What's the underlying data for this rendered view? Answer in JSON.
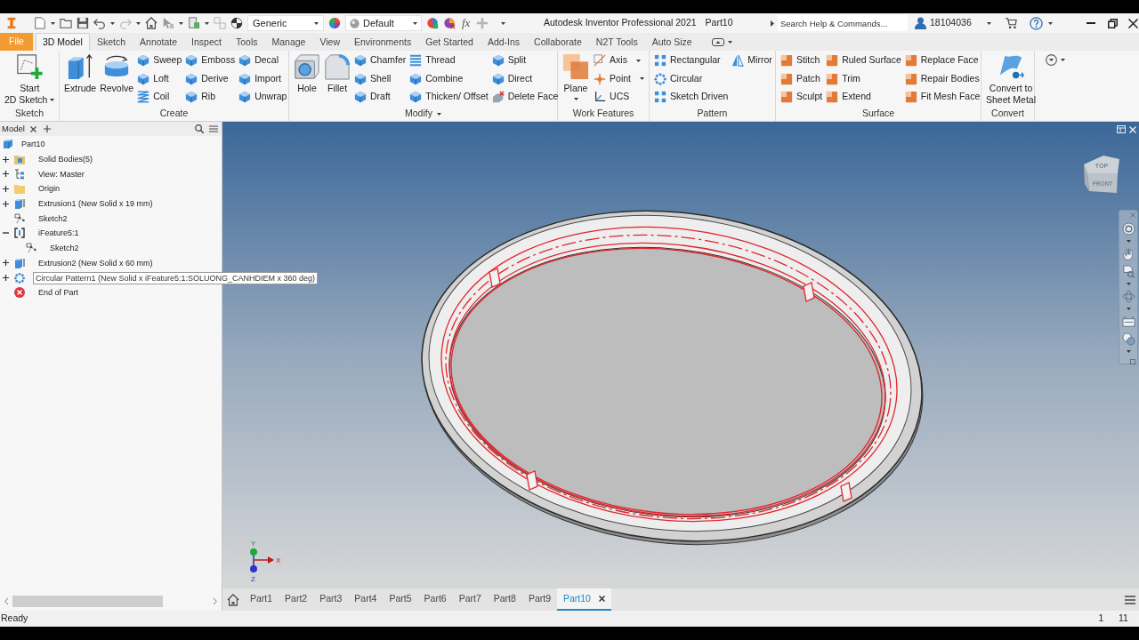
{
  "quick_access": {
    "style": "Generic",
    "appearance": "Default",
    "function_button": "fx"
  },
  "title_bar": {
    "app": "Autodesk Inventor Professional 2021",
    "document": "Part10",
    "search": {
      "placeholder": "Search Help & Commands..."
    },
    "user": "18104036"
  },
  "ribbon_tabs": [
    {
      "label": "File",
      "kind": "file",
      "selected": false
    },
    {
      "label": "3D Model",
      "kind": "tab",
      "selected": true
    },
    {
      "label": "Sketch",
      "kind": "tab",
      "selected": false
    },
    {
      "label": "Annotate",
      "kind": "tab",
      "selected": false
    },
    {
      "label": "Inspect",
      "kind": "tab",
      "selected": false
    },
    {
      "label": "Tools",
      "kind": "tab",
      "selected": false
    },
    {
      "label": "Manage",
      "kind": "tab",
      "selected": false
    },
    {
      "label": "View",
      "kind": "tab",
      "selected": false
    },
    {
      "label": "Environments",
      "kind": "tab",
      "selected": false
    },
    {
      "label": "Get Started",
      "kind": "tab",
      "selected": false
    },
    {
      "label": "Add-Ins",
      "kind": "tab",
      "selected": false
    },
    {
      "label": "Collaborate",
      "kind": "tab",
      "selected": false
    },
    {
      "label": "N2T Tools",
      "kind": "tab",
      "selected": false
    },
    {
      "label": "Auto Size",
      "kind": "tab",
      "selected": false
    }
  ],
  "ribbon_panels": [
    {
      "title": "Sketch",
      "columns": [
        {
          "kind": "large",
          "buttons": [
            {
              "lines": [
                "Start",
                "2D Sketch"
              ],
              "dropdown": true
            }
          ]
        }
      ]
    },
    {
      "title": "Create",
      "columns": [
        {
          "kind": "large",
          "buttons": [
            {
              "lines": [
                "Extrude"
              ]
            }
          ]
        },
        {
          "kind": "large",
          "buttons": [
            {
              "lines": [
                "Revolve"
              ]
            }
          ]
        },
        {
          "kind": "small",
          "buttons": [
            {
              "label": "Sweep"
            },
            {
              "label": "Loft"
            },
            {
              "label": "Coil"
            }
          ]
        },
        {
          "kind": "small",
          "buttons": [
            {
              "label": "Emboss"
            },
            {
              "label": "Derive"
            },
            {
              "label": "Rib"
            }
          ]
        },
        {
          "kind": "small",
          "buttons": [
            {
              "label": "Decal"
            },
            {
              "label": "Import"
            },
            {
              "label": "Unwrap"
            }
          ]
        }
      ]
    },
    {
      "title": "Modify",
      "title_dropdown": true,
      "columns": [
        {
          "kind": "large",
          "buttons": [
            {
              "lines": [
                "Hole"
              ]
            }
          ]
        },
        {
          "kind": "large",
          "buttons": [
            {
              "lines": [
                "Fillet"
              ]
            }
          ]
        },
        {
          "kind": "small",
          "buttons": [
            {
              "label": "Chamfer"
            },
            {
              "label": "Shell"
            },
            {
              "label": "Draft"
            }
          ]
        },
        {
          "kind": "small",
          "buttons": [
            {
              "label": "Thread"
            },
            {
              "label": "Combine"
            },
            {
              "label": "Thicken/ Offset"
            }
          ]
        },
        {
          "kind": "small",
          "buttons": [
            {
              "label": "Split"
            },
            {
              "label": "Direct"
            },
            {
              "label": "Delete Face"
            }
          ]
        }
      ]
    },
    {
      "title": "Work Features",
      "columns": [
        {
          "kind": "large",
          "buttons": [
            {
              "lines": [
                "Plane"
              ],
              "dropdown": true
            }
          ]
        },
        {
          "kind": "small",
          "buttons": [
            {
              "label": "Axis",
              "dropdown": true
            },
            {
              "label": "Point",
              "dropdown": true
            },
            {
              "label": "UCS"
            }
          ]
        }
      ]
    },
    {
      "title": "Pattern",
      "columns": [
        {
          "kind": "small",
          "buttons": [
            {
              "label": "Rectangular"
            },
            {
              "label": "Circular"
            },
            {
              "label": "Sketch Driven"
            }
          ]
        },
        {
          "kind": "small",
          "buttons": [
            {
              "label": "Mirror"
            }
          ]
        }
      ]
    },
    {
      "title": "Surface",
      "columns": [
        {
          "kind": "small",
          "buttons": [
            {
              "label": "Stitch"
            },
            {
              "label": "Patch"
            },
            {
              "label": "Sculpt"
            }
          ]
        },
        {
          "kind": "small",
          "buttons": [
            {
              "label": "Ruled Surface"
            },
            {
              "label": "Trim"
            },
            {
              "label": "Extend"
            }
          ]
        },
        {
          "kind": "small",
          "buttons": [
            {
              "label": "Replace Face"
            },
            {
              "label": "Repair Bodies"
            },
            {
              "label": "Fit Mesh Face"
            }
          ]
        }
      ]
    },
    {
      "title": "Convert",
      "columns": [
        {
          "kind": "large",
          "buttons": [
            {
              "lines": [
                "Convert to",
                "Sheet Metal"
              ]
            }
          ]
        }
      ]
    }
  ],
  "browser": {
    "tab": "Model",
    "root": {
      "label": "Part10",
      "kind": "part",
      "selected": false
    },
    "tree": [
      {
        "label": "Solid Bodies(5)",
        "kind": "bodies",
        "expanded": false,
        "selected": false
      },
      {
        "label": "View: Master",
        "kind": "view",
        "expanded": false,
        "selected": false
      },
      {
        "label": "Origin",
        "kind": "folder",
        "expanded": false,
        "selected": false
      },
      {
        "label": "Extrusion1 (New Solid x 19 mm)",
        "kind": "extrusion",
        "expanded": false,
        "selected": false
      },
      {
        "label": "Sketch2",
        "kind": "sketch",
        "selected": false
      },
      {
        "label": "iFeature5:1",
        "kind": "ifeature",
        "expanded": true,
        "selected": false,
        "children": [
          {
            "label": "Sketch2",
            "kind": "sketch",
            "selected": false
          }
        ]
      },
      {
        "label": "Extrusion2 (New Solid x 60 mm)",
        "kind": "extrusion",
        "expanded": false,
        "selected": false
      },
      {
        "label": "Circular Pattern1 (New Solid x iFeature5:1:SOLUONG_CANHDIEM x 360 deg)",
        "kind": "pattern",
        "expanded": false,
        "selected": true
      },
      {
        "label": "End of Part",
        "kind": "end",
        "selected": false
      }
    ]
  },
  "view_cube": {
    "top": "TOP",
    "front": "FRONT"
  },
  "triad": {
    "x": "X",
    "y": "Y",
    "z": "Z"
  },
  "document_tabs": [
    {
      "label": "Part1",
      "selected": false
    },
    {
      "label": "Part2",
      "selected": false
    },
    {
      "label": "Part3",
      "selected": false
    },
    {
      "label": "Part4",
      "selected": false
    },
    {
      "label": "Part5",
      "selected": false
    },
    {
      "label": "Part6",
      "selected": false
    },
    {
      "label": "Part7",
      "selected": false
    },
    {
      "label": "Part8",
      "selected": false
    },
    {
      "label": "Part9",
      "selected": false
    },
    {
      "label": "Part10",
      "selected": true
    }
  ],
  "status_bar": {
    "message": "Ready",
    "numbers": [
      "1",
      "11"
    ]
  }
}
